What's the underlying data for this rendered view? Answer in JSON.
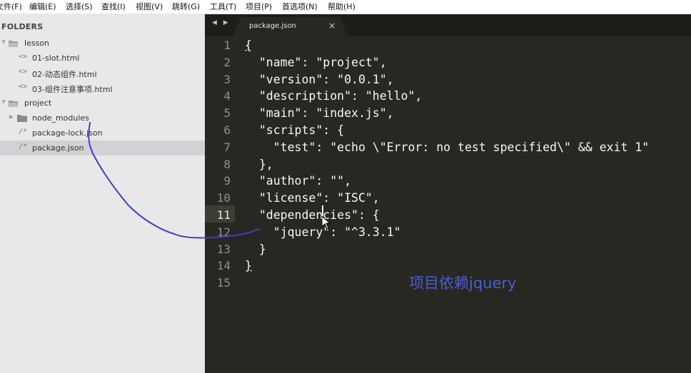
{
  "menu": [
    "文件(F)",
    "编辑(E)",
    "选择(S)",
    "查找(I)",
    "视图(V)",
    "跳转(G)",
    "工具(T)",
    "项目(P)",
    "首选项(N)",
    "帮助(H)"
  ],
  "sidebar": {
    "title": "FOLDERS",
    "tree": [
      {
        "label": "lesson",
        "type": "folder-open"
      },
      {
        "label": "01-slot.html",
        "type": "html"
      },
      {
        "label": "02-动态组件.html",
        "type": "html"
      },
      {
        "label": "03-组件注意事项.html",
        "type": "html"
      },
      {
        "label": "project",
        "type": "folder-open"
      },
      {
        "label": "node_modules",
        "type": "folder-closed"
      },
      {
        "label": "package-lock.json",
        "type": "json"
      },
      {
        "label": "package.json",
        "type": "json",
        "selected": true
      }
    ],
    "icons": {
      "html": "<>",
      "json": "/*"
    }
  },
  "tabs": {
    "nav": "◀ ▶",
    "active_tab": "package.json",
    "close": "×"
  },
  "editor": {
    "line_numbers": [
      "1",
      "2",
      "3",
      "4",
      "5",
      "6",
      "7",
      "8",
      "9",
      "10",
      "11",
      "12",
      "13",
      "14",
      "15"
    ],
    "active_line": "11",
    "lines": [
      "{",
      "  \"name\": \"project\",",
      "  \"version\": \"0.0.1\",",
      "  \"description\": \"hello\",",
      "  \"main\": \"index.js\",",
      "  \"scripts\": {",
      "    \"test\": \"echo \\\"Error: no test specified\\\" && exit 1\"",
      "  },",
      "  \"author\": \"\",",
      "  \"license\": \"ISC\",",
      "  \"dependencies\": {",
      "    \"jquery\": \"^3.3.1\"",
      "  }",
      "}",
      ""
    ]
  },
  "annotation": "项目依赖jquery",
  "colors": {
    "annotation": "#4a5bd8",
    "editor_bg": "#272822",
    "sidebar_bg": "#e8e8e8"
  }
}
